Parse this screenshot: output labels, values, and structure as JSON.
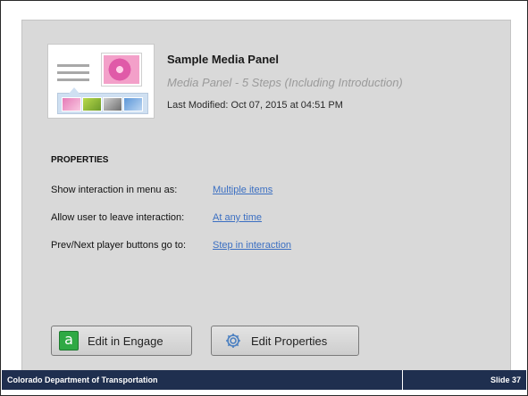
{
  "panel": {
    "title": "Sample Media Panel",
    "subtitle": "Media Panel - 5 Steps (Including Introduction)",
    "modified": "Last Modified: Oct 07, 2015 at 04:51 PM"
  },
  "properties": {
    "heading": "PROPERTIES",
    "items": [
      {
        "label": "Show interaction in menu as:",
        "value": "Multiple items"
      },
      {
        "label": "Allow user to leave interaction:",
        "value": "At any time"
      },
      {
        "label": "Prev/Next player buttons go to:",
        "value": "Step in interaction"
      }
    ]
  },
  "buttons": {
    "engage_label": "Edit in Engage",
    "engage_icon_glyph": "a",
    "properties_label": "Edit Properties"
  },
  "icons": {
    "engage": "engage-app-icon",
    "properties": "gear-icon",
    "thumbnail": "media-panel-thumbnail"
  },
  "footer": {
    "organization": "Colorado Department of Transportation",
    "slide": "Slide 37"
  },
  "colors": {
    "panel_bg": "#d9d9d9",
    "link": "#3b6fc2",
    "footer_bg": "#1f2f4f",
    "engage_green": "#2fa944"
  }
}
